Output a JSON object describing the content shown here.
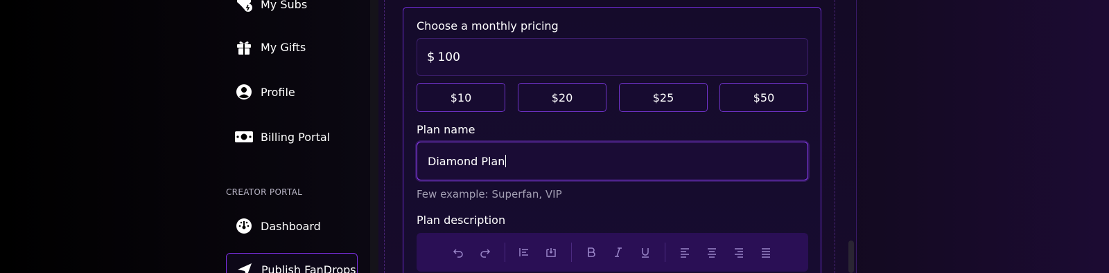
{
  "sidebar": {
    "items": [
      {
        "label": "My Subs",
        "icon": "subscriptions-icon"
      },
      {
        "label": "My Gifts",
        "icon": "gift-icon"
      },
      {
        "label": "Profile",
        "icon": "user-icon"
      },
      {
        "label": "Billing Portal",
        "icon": "money-icon"
      }
    ],
    "section_title": "CREATOR PORTAL",
    "creator_items": [
      {
        "label": "Dashboard",
        "icon": "dashboard-icon"
      },
      {
        "label": "Publish FanDrops",
        "icon": "send-icon"
      }
    ]
  },
  "form": {
    "pricing_label": "Choose a monthly pricing",
    "currency_symbol": "$",
    "price_value": "100",
    "presets": [
      "$10",
      "$20",
      "$25",
      "$50"
    ],
    "plan_name_label": "Plan name",
    "plan_name_value": "Diamond Plan",
    "plan_name_helper": "Few example: Superfan, VIP",
    "plan_description_label": "Plan description"
  },
  "toolbar": {
    "buttons": [
      "undo-icon",
      "redo-icon",
      "blockquote-icon",
      "embed-icon",
      "bold-icon",
      "italic-icon",
      "underline-icon",
      "align-left-icon",
      "align-center-icon",
      "align-right-icon",
      "align-justify-icon"
    ]
  },
  "colors": {
    "accent": "#7a2ee0",
    "toolbar_bg": "#2a0f55",
    "input_bg": "#1a0c35"
  }
}
